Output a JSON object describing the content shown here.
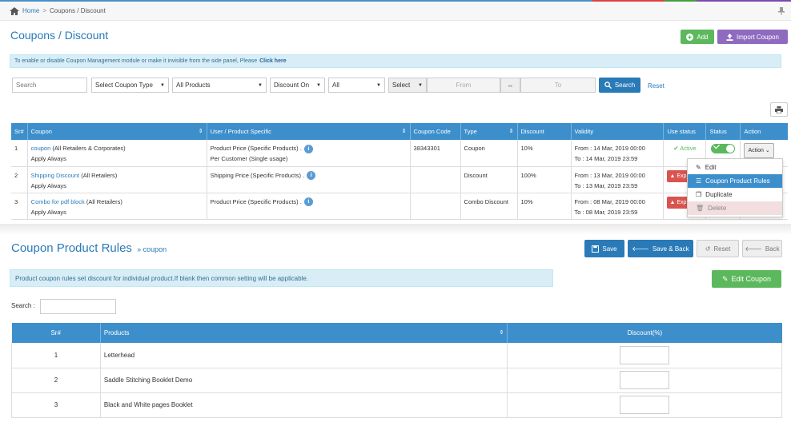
{
  "breadcrumb": {
    "home": "Home",
    "sep": ">",
    "current": "Coupons / Discount"
  },
  "page_title": "Coupons / Discount",
  "header_buttons": {
    "add": "Add",
    "import": "Import Coupon"
  },
  "info_bar": {
    "text": "To enable or disable Coupon Management module or make it invisible from the side panel, Please",
    "link": "Click here"
  },
  "filters": {
    "search_placeholder": "Search",
    "coupon_type": "Select Coupon Type",
    "products": "All Products",
    "discount_on": "Discount On",
    "all": "All",
    "select": "Select",
    "from": "From",
    "to": "To",
    "search_button": "Search",
    "reset": "Reset"
  },
  "coupon_table": {
    "headers": [
      "Sr#",
      "Coupon",
      "User / Product Specific",
      "Coupon Code",
      "Type",
      "Discount",
      "Validity",
      "Use status",
      "Status",
      "Action"
    ],
    "rows": [
      {
        "sr": "1",
        "coupon": "coupon",
        "scope": "(All Retailers & Corporates)",
        "apply": "Apply Always",
        "specific1": "Product Price (Specific Products) .",
        "specific2": "Per Customer (Single usage)",
        "code": "38343301",
        "type": "Coupon",
        "discount": "10%",
        "from": "From : 14 Mar, 2019 00:00",
        "to": "To : 14 Mar, 2019 23:59",
        "use_status": "Active",
        "action": "Action"
      },
      {
        "sr": "2",
        "coupon": "Shipping Discount",
        "scope": "(All Retailers)",
        "apply": "Apply Always",
        "specific1": "Shipping Price (Specific Products) .",
        "specific2": "",
        "code": "",
        "type": "Discount",
        "discount": "100%",
        "from": "From : 13 Mar, 2019 00:00",
        "to": "To : 13 Mar, 2019 23:59",
        "use_status": "Exp"
      },
      {
        "sr": "3",
        "coupon": "Combo for pdf block",
        "scope": "(All Retailers)",
        "apply": "Apply Always",
        "specific1": "Product Price (Specific Products) .",
        "specific2": "",
        "code": "",
        "type": "Combo Discount",
        "discount": "10%",
        "from": "From : 08 Mar, 2019 00:00",
        "to": "To : 08 Mar, 2019 23:59",
        "use_status": "Exp"
      }
    ]
  },
  "action_menu": {
    "edit": "Edit",
    "rules": "Coupon Product Rules",
    "duplicate": "Duplicate",
    "delete": "Delete"
  },
  "product_rules": {
    "title": "Coupon Product Rules",
    "sub": "» coupon",
    "save": "Save",
    "save_back": "Save & Back",
    "reset": "Reset",
    "back": "Back",
    "info": "Product coupon rules set discount for individual product.If blank then common setting will be applicable.",
    "edit_coupon": "Edit Coupon",
    "search_label": "Search :",
    "headers": [
      "Sr#",
      "Products",
      "Discount(%)"
    ],
    "rows": [
      {
        "sr": "1",
        "product": "Letterhead"
      },
      {
        "sr": "2",
        "product": "Saddle Stitching Booklet Demo"
      },
      {
        "sr": "3",
        "product": "Black and White pages Booklet"
      }
    ]
  },
  "colors": {
    "primary": "#2a7ab8",
    "header": "#3d8fcc",
    "success": "#5cb85c",
    "purple": "#8e6bbf",
    "danger": "#d9534f"
  }
}
